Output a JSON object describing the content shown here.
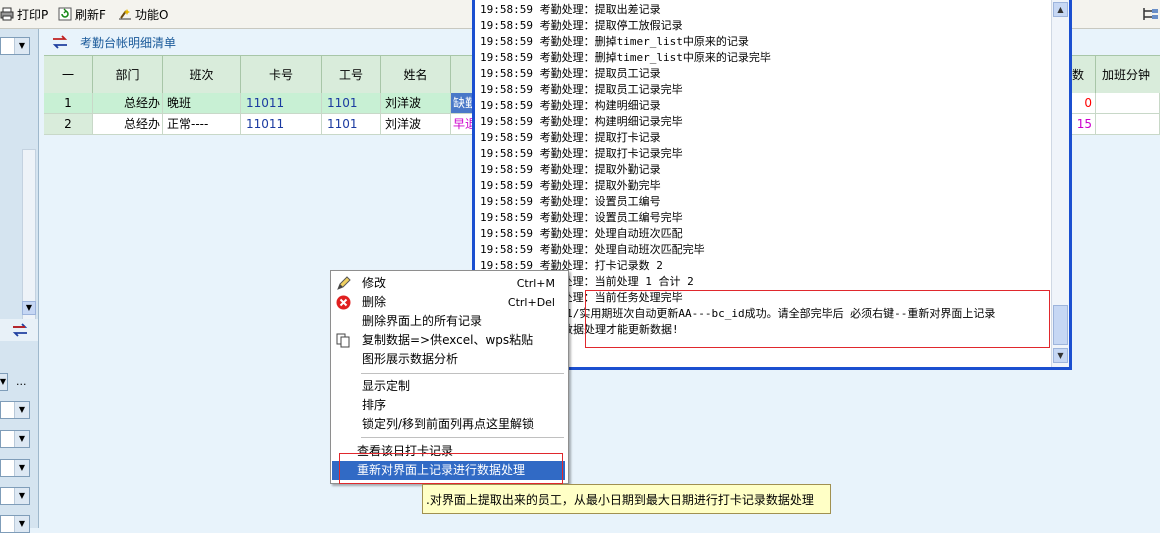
{
  "toolbar": {
    "print_label": "打印P",
    "refresh_label": "刷新F",
    "function_label": "功能O"
  },
  "grid": {
    "title": "考勤台帐明细清单",
    "columns": [
      "一",
      "部门",
      "班次",
      "卡号",
      "工号",
      "姓名",
      "数",
      "加班分钟数"
    ],
    "rows": [
      {
        "idx": "1",
        "dept": "总经办",
        "shift": "晚班",
        "card": "11011",
        "empno": "1101",
        "name": "刘洋波",
        "status": "缺勤",
        "count": "0",
        "overtime": ""
      },
      {
        "idx": "2",
        "dept": "总经办",
        "shift": "正常----",
        "card": "11011",
        "empno": "1101",
        "name": "刘洋波",
        "status": "早退",
        "count": "15",
        "overtime": ""
      }
    ]
  },
  "log": {
    "lines": [
      "19:58:59 考勤处理：提取出差记录",
      "19:58:59 考勤处理：提取停工放假记录",
      "19:58:59 考勤处理：删掉timer_list中原来的记录",
      "19:58:59 考勤处理：删掉timer_list中原来的记录完毕",
      "19:58:59 考勤处理：提取员工记录",
      "19:58:59 考勤处理：提取员工记录完毕",
      "19:58:59 考勤处理：构建明细记录",
      "19:58:59 考勤处理：构建明细记录完毕",
      "19:58:59 考勤处理：提取打卡记录",
      "19:58:59 考勤处理：提取打卡记录完毕",
      "19:58:59 考勤处理：提取外勤记录",
      "19:58:59 考勤处理：提取外勤完毕",
      "19:58:59 考勤处理：设置员工编号",
      "19:58:59 考勤处理：设置员工编号完毕",
      "19:58:59 考勤处理：处理自动班次匹配",
      "19:58:59 考勤处理：处理自动班次匹配完毕",
      "19:58:59 考勤处理：打卡记录数 2",
      "19:58:59 考勤处理：当前处理 1 合计 2",
      "19:58:59 考勤处理：当前任务处理完毕",
      "19:58:59 21201/实用期班次自动更新AA---bc_id成功。请全部完毕后 必须右键--重新对界面上记录",
      "进行数据处理才能更新数据!"
    ]
  },
  "context_menu": {
    "items": [
      {
        "label": "修改",
        "shortcut": "Ctrl+M",
        "icon": "edit-icon"
      },
      {
        "label": "删除",
        "shortcut": "Ctrl+Del",
        "icon": "delete-icon"
      },
      {
        "label": "删除界面上的所有记录",
        "shortcut": ""
      },
      {
        "label": "复制数据=>供excel、wps粘贴",
        "shortcut": "",
        "icon": "copy-icon"
      },
      {
        "label": "图形展示数据分析",
        "shortcut": ""
      },
      {
        "label": "显示定制",
        "shortcut": ""
      },
      {
        "label": "排序",
        "shortcut": ""
      },
      {
        "label": "锁定列/移到前面列再点这里解锁",
        "shortcut": ""
      },
      {
        "label": "查看该日打卡记录",
        "shortcut": ""
      },
      {
        "label": "重新对界面上记录进行数据处理",
        "shortcut": ""
      }
    ]
  },
  "tooltip": {
    "text": "对界面上提取出来的员工，从最小日期到最大日期进行打卡记录数据处理"
  },
  "left": {
    "ellipsis": "..."
  },
  "colors": {
    "selected_row_bg": "#c8f0d4",
    "menu_highlight": "#316ac5",
    "log_border": "#1b4fd0",
    "annotation_red": "#e0282d",
    "count_red": "#ff0000",
    "count_magenta": "#cc00cc"
  }
}
